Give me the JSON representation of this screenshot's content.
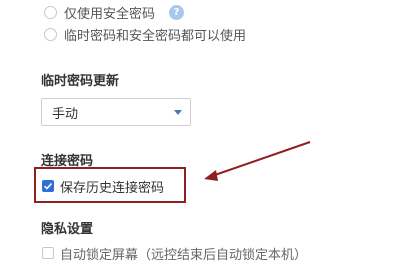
{
  "password_options": {
    "only_security_password": "仅使用安全密码",
    "help_icon_glyph": "?",
    "temp_and_security": "临时密码和安全密码都可以使用"
  },
  "temp_password_update": {
    "title": "临时密码更新",
    "selected": "手动"
  },
  "connection_password": {
    "title": "连接密码",
    "save_history_label": "保存历史连接密码",
    "save_history_checked": true
  },
  "privacy": {
    "title": "隐私设置",
    "auto_lock_label": "自动锁定屏幕（远控结束后自动锁定本机）",
    "auto_lock_checked": false
  },
  "colors": {
    "accent_blue": "#2f6fd6",
    "annotation_red": "#8f1f20",
    "help_icon_bg": "#a9c7ee"
  }
}
